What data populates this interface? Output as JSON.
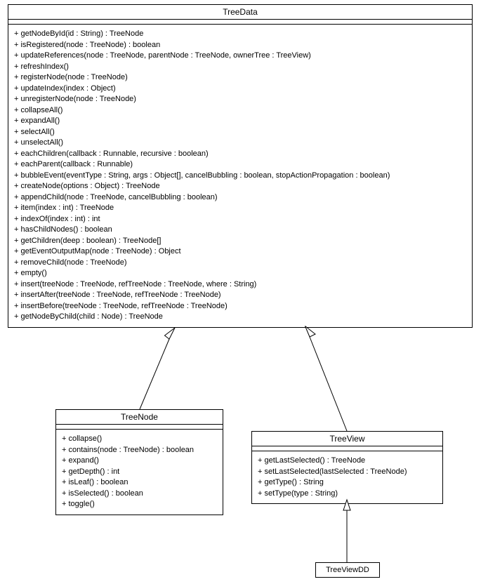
{
  "chart_data": {
    "type": "uml_class_diagram",
    "classes": [
      {
        "name": "TreeData",
        "attributes": [],
        "operations": [
          "+ getNodeById(id : String) : TreeNode",
          "+ isRegistered(node : TreeNode) : boolean",
          "+ updateReferences(node : TreeNode, parentNode : TreeNode, ownerTree : TreeView)",
          "+ refreshIndex()",
          "+ registerNode(node : TreeNode)",
          "+ updateIndex(index : Object)",
          "+ unregisterNode(node : TreeNode)",
          "+ collapseAll()",
          "+ expandAll()",
          "+ selectAll()",
          "+ unselectAll()",
          "+ eachChildren(callback : Runnable, recursive : boolean)",
          "+ eachParent(callback : Runnable)",
          "+ bubbleEvent(eventType : String, args : Object[], cancelBubbling : boolean, stopActionPropagation : boolean)",
          "+ createNode(options : Object) : TreeNode",
          "+ appendChild(node : TreeNode, cancelBubbling : boolean)",
          "+ item(index : int) : TreeNode",
          "+ indexOf(index : int) : int",
          "+ hasChildNodes() : boolean",
          "+ getChildren(deep : boolean) : TreeNode[]",
          "+ getEventOutputMap(node : TreeNode) : Object",
          "+ removeChild(node : TreeNode)",
          "+ empty()",
          "+ insert(treeNode : TreeNode, refTreeNode : TreeNode, where : String)",
          "+ insertAfter(treeNode : TreeNode, refTreeNode : TreeNode)",
          "+ insertBefore(treeNode : TreeNode, refTreeNode : TreeNode)",
          "+ getNodeByChild(child : Node) : TreeNode"
        ]
      },
      {
        "name": "TreeNode",
        "attributes": [],
        "operations": [
          "+ collapse()",
          "+ contains(node : TreeNode) : boolean",
          "+ expand()",
          "+ getDepth() : int",
          "+ isLeaf() : boolean",
          "+ isSelected() : boolean",
          "+ toggle()"
        ]
      },
      {
        "name": "TreeView",
        "attributes": [],
        "operations": [
          "+ getLastSelected() : TreeNode",
          "+ setLastSelected(lastSelected : TreeNode)",
          "+ getType() : String",
          "+ setType(type : String)"
        ]
      },
      {
        "name": "TreeViewDD",
        "attributes": [],
        "operations": []
      }
    ],
    "relationships": [
      {
        "type": "generalization",
        "from": "TreeNode",
        "to": "TreeData"
      },
      {
        "type": "generalization",
        "from": "TreeView",
        "to": "TreeData"
      },
      {
        "type": "generalization",
        "from": "TreeViewDD",
        "to": "TreeView"
      }
    ]
  },
  "classes": {
    "treedata": {
      "title": "TreeData"
    },
    "treenode": {
      "title": "TreeNode"
    },
    "treeview": {
      "title": "TreeView"
    },
    "treeviewdd": {
      "title": "TreeViewDD"
    }
  }
}
